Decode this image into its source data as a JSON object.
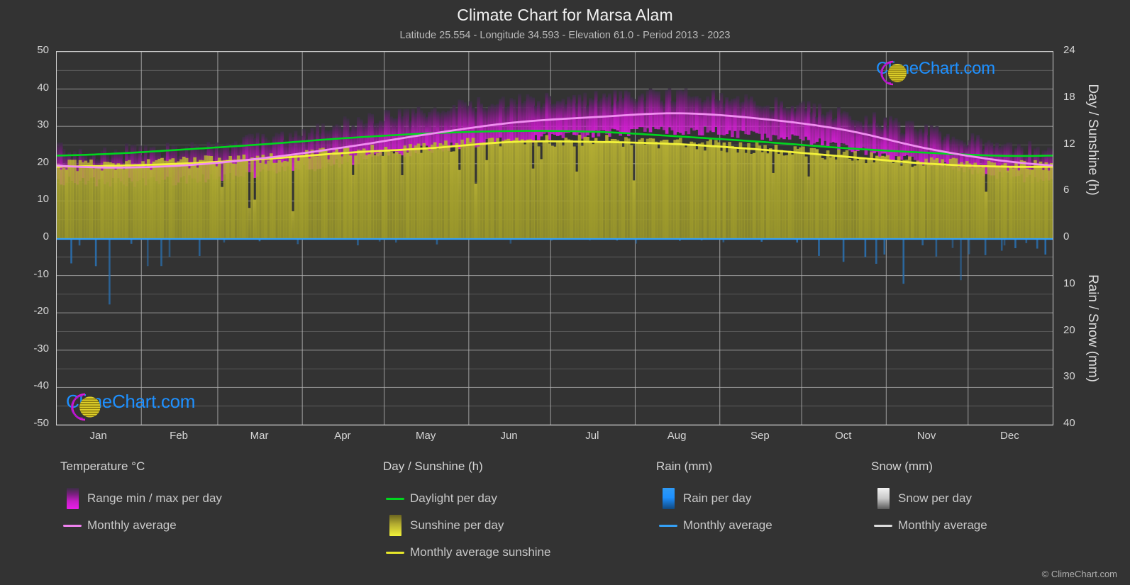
{
  "header": {
    "title": "Climate Chart for Marsa Alam",
    "subtitle": "Latitude 25.554 - Longitude 34.593 - Elevation 61.0 - Period 2013 - 2023"
  },
  "axes": {
    "y_left_label": "Temperature °C",
    "y_right_top_label": "Day / Sunshine (h)",
    "y_right_bottom_label": "Rain / Snow (mm)",
    "y_left_ticks": [
      "50",
      "40",
      "30",
      "20",
      "10",
      "0",
      "-10",
      "-20",
      "-30",
      "-40",
      "-50"
    ],
    "y_right_top_ticks": [
      "24",
      "18",
      "12",
      "6",
      "0"
    ],
    "y_right_bottom_ticks": [
      "0",
      "10",
      "20",
      "30",
      "40"
    ],
    "x_ticks": [
      "Jan",
      "Feb",
      "Mar",
      "Apr",
      "May",
      "Jun",
      "Jul",
      "Aug",
      "Sep",
      "Oct",
      "Nov",
      "Dec"
    ]
  },
  "legend": {
    "columns": [
      {
        "heading": "Temperature °C",
        "items": [
          {
            "label": "Range min / max per day",
            "key": "gradient-magenta",
            "color": "#e619e6"
          },
          {
            "label": "Monthly average",
            "key": "line",
            "color": "#ee82ee"
          }
        ]
      },
      {
        "heading": "Day / Sunshine (h)",
        "items": [
          {
            "label": "Daylight per day",
            "key": "line",
            "color": "#00d61e"
          },
          {
            "label": "Sunshine per day",
            "key": "gradient-yellow",
            "color": "#f0f03c"
          },
          {
            "label": "Monthly average sunshine",
            "key": "line",
            "color": "#e8e82a"
          }
        ]
      },
      {
        "heading": "Rain (mm)",
        "items": [
          {
            "label": "Rain per day",
            "key": "gradient-blue",
            "color": "#1e90ff"
          },
          {
            "label": "Monthly average",
            "key": "line",
            "color": "#35a0f5"
          }
        ]
      },
      {
        "heading": "Snow (mm)",
        "items": [
          {
            "label": "Snow per day",
            "key": "gradient-white",
            "color": "#e8e8e8"
          },
          {
            "label": "Monthly average",
            "key": "line",
            "color": "#dcdcdc"
          }
        ]
      }
    ]
  },
  "branding": {
    "wordmark": "ClimeChart.com",
    "copyright": "© ClimeChart.com",
    "arc_color": "#d619d6",
    "sphere_color": "#e0d020",
    "text_color": "#1e90ff"
  },
  "colors": {
    "background": "#333333",
    "plot_background": "#333333",
    "grid": "#8c8c8c",
    "axis": "#cfcfcf",
    "temp_range": "#c41ec4",
    "temp_avg": "#ee82ee",
    "daylight": "#00d61e",
    "sunshine_fill": "#a8a42e",
    "sunshine_avg": "#f0f03c",
    "rain": "#2f7fc4",
    "rain_avg": "#35a0f5"
  },
  "chart_data": {
    "type": "area",
    "title": "Climate Chart for Marsa Alam",
    "subtitle": "Latitude 25.554 - Longitude 34.593 - Elevation 61.0 - Period 2013 - 2023",
    "xlabel": "",
    "ylabel": "Temperature °C",
    "ylim": [
      -50,
      50
    ],
    "y2_top_label": "Day / Sunshine (h)",
    "y2_top_lim": [
      0,
      24
    ],
    "y2_bottom_label": "Rain / Snow (mm)",
    "y2_bottom_lim": [
      0,
      40
    ],
    "grid": true,
    "legend_position": "below",
    "categories": [
      "Jan",
      "Feb",
      "Mar",
      "Apr",
      "May",
      "Jun",
      "Jul",
      "Aug",
      "Sep",
      "Oct",
      "Nov",
      "Dec"
    ],
    "series": [
      {
        "name": "Monthly average temperature (°C)",
        "unit": "°C",
        "color": "#ee82ee",
        "values": [
          19.0,
          19.5,
          21.5,
          24.5,
          28.0,
          31.0,
          32.5,
          33.5,
          32.0,
          29.0,
          24.0,
          20.5
        ]
      },
      {
        "name": "Monthly max temperature (°C)",
        "unit": "°C",
        "color": "#c41ec4",
        "values": [
          23.0,
          24.0,
          26.5,
          30.5,
          34.0,
          36.5,
          37.5,
          38.0,
          36.5,
          33.0,
          28.5,
          24.5
        ]
      },
      {
        "name": "Monthly min temperature (°C)",
        "unit": "°C",
        "color": "#c41ec4",
        "values": [
          15.0,
          15.5,
          17.5,
          20.5,
          24.0,
          26.5,
          28.0,
          29.0,
          27.5,
          24.5,
          20.0,
          16.5
        ]
      },
      {
        "name": "Daylight per day (h)",
        "unit": "h",
        "color": "#00d61e",
        "values": [
          10.8,
          11.4,
          12.1,
          12.9,
          13.5,
          13.8,
          13.7,
          13.1,
          12.4,
          11.6,
          11.0,
          10.6
        ]
      },
      {
        "name": "Monthly average sunshine (h)",
        "unit": "h",
        "color": "#e8e82a",
        "values": [
          9.3,
          9.6,
          10.2,
          11.0,
          11.6,
          12.4,
          12.4,
          12.1,
          11.4,
          10.5,
          9.6,
          9.2
        ]
      },
      {
        "name": "Monthly average rain (mm)",
        "unit": "mm",
        "color": "#35a0f5",
        "values": [
          0.3,
          0.1,
          0.1,
          0.0,
          0.0,
          0.0,
          0.0,
          0.0,
          0.0,
          0.2,
          0.4,
          0.2
        ]
      },
      {
        "name": "Monthly average snow (mm)",
        "unit": "mm",
        "color": "#dcdcdc",
        "values": [
          0,
          0,
          0,
          0,
          0,
          0,
          0,
          0,
          0,
          0,
          0,
          0
        ]
      }
    ]
  }
}
